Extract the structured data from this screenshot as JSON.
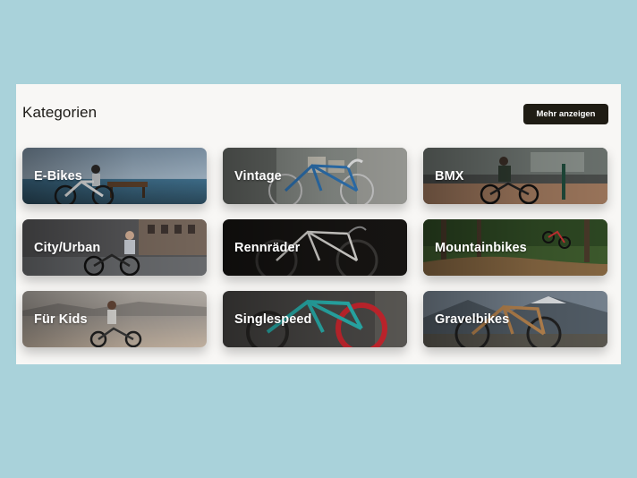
{
  "section": {
    "title": "Kategorien",
    "more_label": "Mehr anzeigen"
  },
  "categories": [
    {
      "label": "E-Bikes"
    },
    {
      "label": "Vintage"
    },
    {
      "label": "BMX"
    },
    {
      "label": "City/Urban"
    },
    {
      "label": "Rennräder"
    },
    {
      "label": "Mountainbikes"
    },
    {
      "label": "Für Kids"
    },
    {
      "label": "Singlespeed"
    },
    {
      "label": "Gravelbikes"
    }
  ],
  "colors": {
    "page_background": "#a9d2da",
    "panel_background": "#f8f7f5",
    "button_background": "#1f1c14",
    "label_text": "#ffffff"
  }
}
